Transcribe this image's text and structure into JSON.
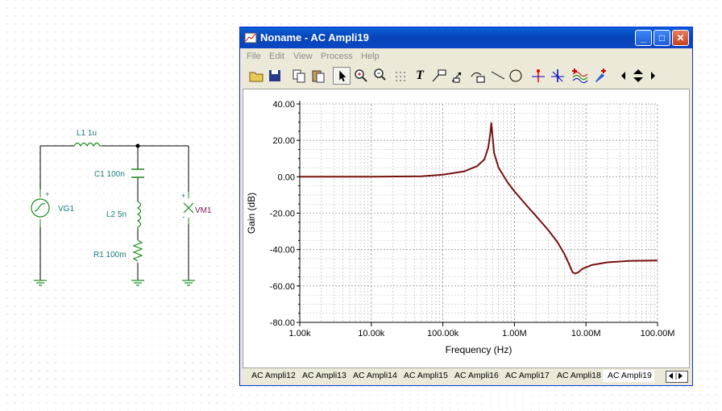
{
  "schematic": {
    "l1_label": "L1 1u",
    "c1_label": "C1 100n",
    "l2_label": "L2 5n",
    "r1_label": "R1 100m",
    "vg1_label": "VG1",
    "vm1_label": "VM1",
    "plus": "+",
    "minus": "-"
  },
  "window": {
    "title": "Noname - AC Ampli19",
    "minimize": "_",
    "maximize": "□",
    "close": "✕"
  },
  "menu": [
    "File",
    "Edit",
    "View",
    "Process",
    "Help"
  ],
  "toolbar": {
    "icons": [
      "open-folder-icon",
      "save-icon",
      "copy-icon",
      "paste-icon",
      "pointer-icon",
      "zoom-in-icon",
      "zoom-100-icon",
      "grid-icon",
      "text-icon",
      "label-icon",
      "arrow-label-icon",
      "axis-label-icon",
      "line-icon",
      "ellipse-icon",
      "cursor-a-icon",
      "cursor-b-icon",
      "curves-icon",
      "marker-icon",
      "arrow-left-icon",
      "arrow-updown-icon",
      "arrow-right-icon"
    ],
    "text_tool": "T"
  },
  "chart_data": {
    "type": "line",
    "xlabel": "Frequency (Hz)",
    "ylabel": "Gain (dB)",
    "x_scale": "log",
    "xlim": [
      1000,
      100000000
    ],
    "ylim": [
      -80,
      40
    ],
    "x_ticks": [
      "1.00k",
      "10.00k",
      "100.00k",
      "1.00M",
      "10.00M",
      "100.00M"
    ],
    "y_ticks": [
      "40.00",
      "20.00",
      "0.00",
      "-20.00",
      "-40.00",
      "-60.00",
      "-80.00"
    ],
    "grid": true,
    "series": [
      {
        "color": "#7a1010",
        "points": [
          [
            1000,
            0
          ],
          [
            10000,
            0.02
          ],
          [
            50000,
            0.3
          ],
          [
            100000,
            1.1
          ],
          [
            200000,
            3.0
          ],
          [
            300000,
            5.8
          ],
          [
            380000,
            9.5
          ],
          [
            430000,
            16
          ],
          [
            460000,
            24
          ],
          [
            475000,
            29.5
          ],
          [
            490000,
            24
          ],
          [
            520000,
            13
          ],
          [
            600000,
            5
          ],
          [
            800000,
            -3
          ],
          [
            1000000,
            -8
          ],
          [
            1500000,
            -16
          ],
          [
            2000000,
            -21.5
          ],
          [
            3000000,
            -29.5
          ],
          [
            4000000,
            -36
          ],
          [
            5000000,
            -42.5
          ],
          [
            5800000,
            -48
          ],
          [
            6500000,
            -52.5
          ],
          [
            7070000,
            -53.2
          ],
          [
            7800000,
            -52.5
          ],
          [
            9000000,
            -50.5
          ],
          [
            12000000,
            -48.5
          ],
          [
            20000000,
            -47
          ],
          [
            40000000,
            -46.2
          ],
          [
            100000000,
            -46
          ]
        ]
      }
    ]
  },
  "tabs": [
    "AC Ampli12",
    "AC Ampli13",
    "AC Ampli14",
    "AC Ampli15",
    "AC Ampli16",
    "AC Ampli17",
    "AC Ampli18",
    "AC Ampli19"
  ],
  "active_tab": "AC Ampli19"
}
